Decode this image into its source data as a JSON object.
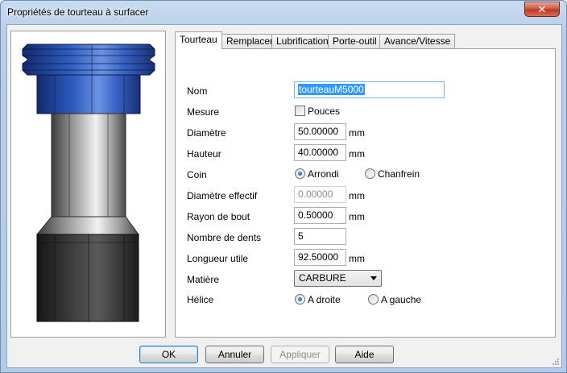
{
  "window": {
    "title": "Propriétés de tourteau à surfacer",
    "close_glyph": "✕"
  },
  "tabs": [
    {
      "label": "Tourteau",
      "active": true
    },
    {
      "label": "Remplacer",
      "active": false
    },
    {
      "label": "Lubrification",
      "active": false
    },
    {
      "label": "Porte-outil",
      "active": false
    },
    {
      "label": "Avance/Vitesse",
      "active": false
    }
  ],
  "form": {
    "nom": {
      "label": "Nom",
      "value": "tourteauM5000"
    },
    "mesure": {
      "label": "Mesure",
      "checkbox_label": "Pouces",
      "checked": false
    },
    "diametre": {
      "label": "Diamètre",
      "value": "50.00000",
      "unit": "mm"
    },
    "hauteur": {
      "label": "Hauteur",
      "value": "40.00000",
      "unit": "mm"
    },
    "coin": {
      "label": "Coin",
      "option1": "Arrondi",
      "option2": "Chanfrein",
      "selected": "Arrondi"
    },
    "diametre_effectif": {
      "label": "Diamètre effectif",
      "value": "0.00000",
      "unit": "mm",
      "disabled": true
    },
    "rayon_de_bout": {
      "label": "Rayon de bout",
      "value": "0.50000",
      "unit": "mm"
    },
    "nombre_de_dents": {
      "label": "Nombre de dents",
      "value": "5"
    },
    "longueur_utile": {
      "label": "Longueur utile",
      "value": "92.50000",
      "unit": "mm"
    },
    "matiere": {
      "label": "Matière",
      "value": "CARBURE"
    },
    "helice": {
      "label": "Hélice",
      "option1": "A droite",
      "option2": "A gauche",
      "selected": "A droite"
    }
  },
  "buttons": {
    "ok": "OK",
    "annuler": "Annuler",
    "appliquer": "Appliquer",
    "aide": "Aide"
  },
  "colors": {
    "tool_holder_blue": "#2a55b0",
    "tool_body_gray": "#9a9a9a",
    "tool_base_dark": "#3a3a3a",
    "selection": "#3399ff"
  }
}
